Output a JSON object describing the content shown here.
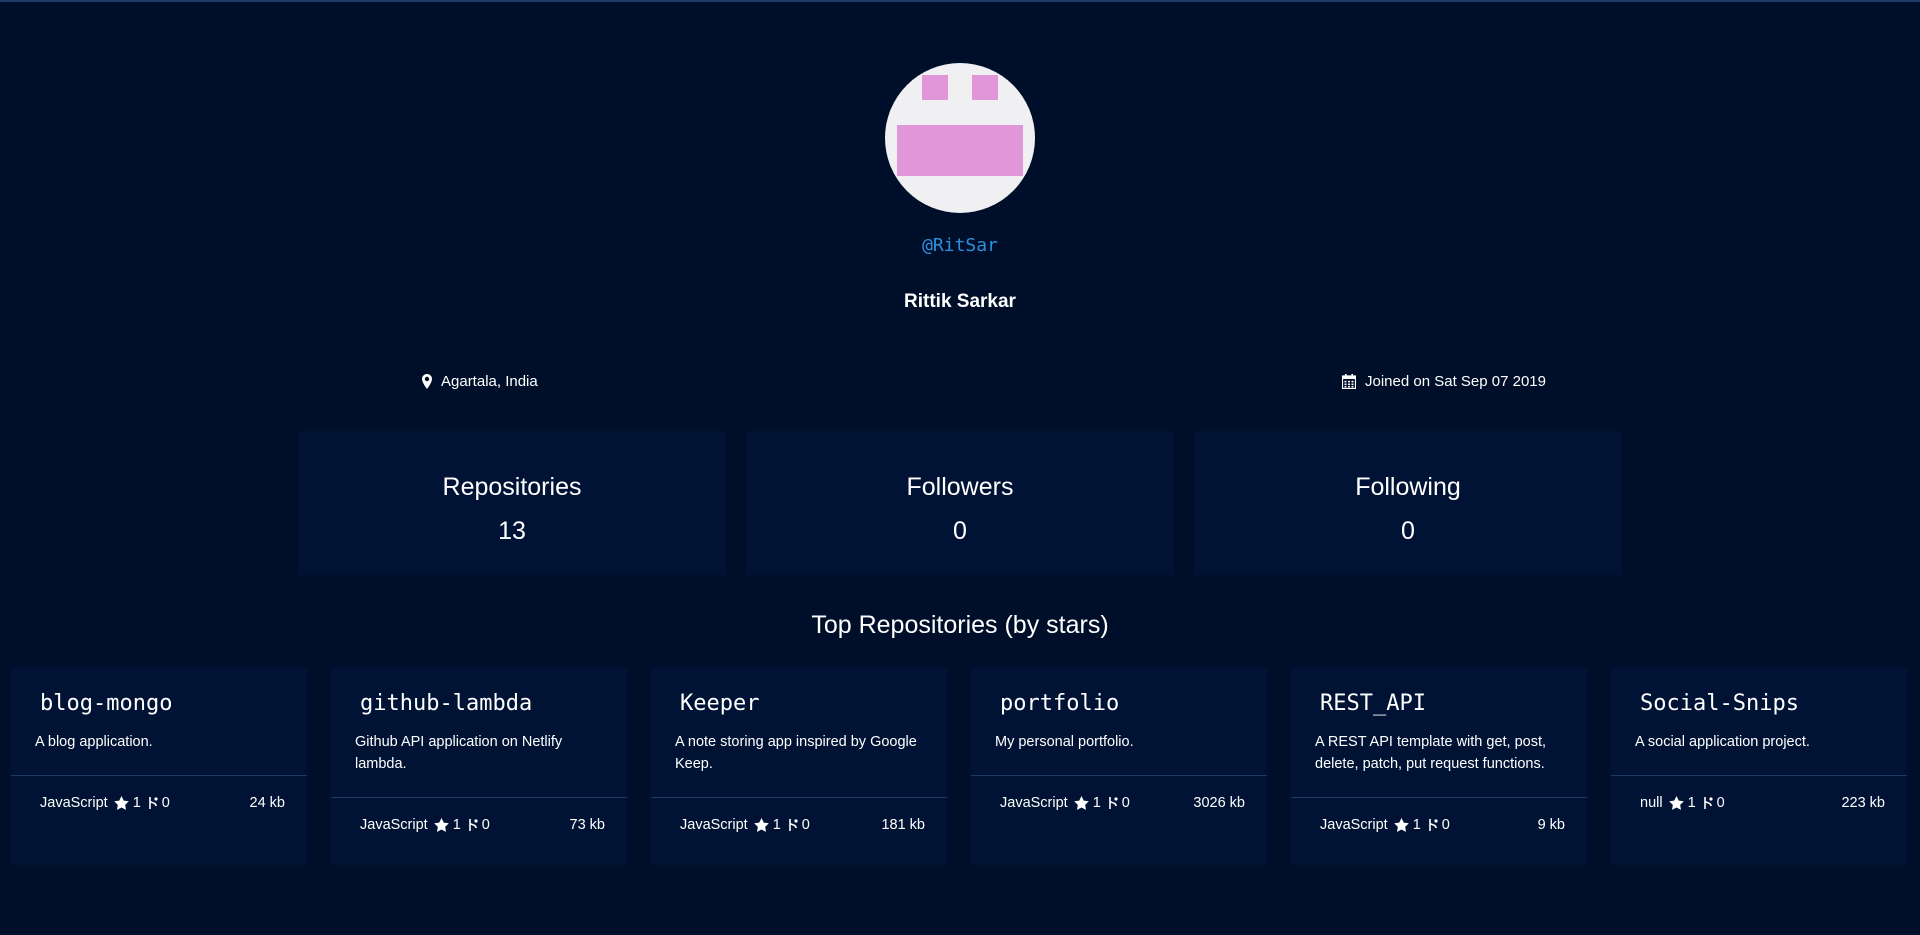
{
  "profile": {
    "handle": "@RitSar",
    "name": "Rittik Sarkar",
    "location": "Agartala, India",
    "joined": "Joined on Sat Sep 07 2019",
    "avatar_colors": {
      "background": "#f0f0f2",
      "foreground": "#e196da"
    }
  },
  "stats": [
    {
      "label": "Repositories",
      "value": "13"
    },
    {
      "label": "Followers",
      "value": "0"
    },
    {
      "label": "Following",
      "value": "0"
    }
  ],
  "top_repos_title": "Top Repositories (by stars)",
  "repos": [
    {
      "name": "blog-mongo",
      "description": "A blog application.",
      "language": "JavaScript",
      "stars": "1",
      "forks": "0",
      "size": "24 kb"
    },
    {
      "name": "github-lambda",
      "description": "Github API application on Netlify lambda.",
      "language": "JavaScript",
      "stars": "1",
      "forks": "0",
      "size": "73 kb"
    },
    {
      "name": "Keeper",
      "description": "A note storing app inspired by Google Keep.",
      "language": "JavaScript",
      "stars": "1",
      "forks": "0",
      "size": "181 kb"
    },
    {
      "name": "portfolio",
      "description": "My personal portfolio.",
      "language": "JavaScript",
      "stars": "1",
      "forks": "0",
      "size": "3026 kb"
    },
    {
      "name": "REST_API",
      "description": "A REST API template with get, post, delete, patch, put request functions.",
      "language": "JavaScript",
      "stars": "1",
      "forks": "0",
      "size": "9 kb"
    },
    {
      "name": "Social-Snips",
      "description": "A social application project.",
      "language": "null",
      "stars": "1",
      "forks": "0",
      "size": "223 kb"
    }
  ],
  "icons": {
    "location": "map-marker-icon",
    "joined": "calendar-icon",
    "stars": "star-icon",
    "forks": "fork-icon"
  },
  "colors": {
    "background": "#000f29",
    "card": "#001334",
    "handle_link": "#2d8fe0"
  }
}
